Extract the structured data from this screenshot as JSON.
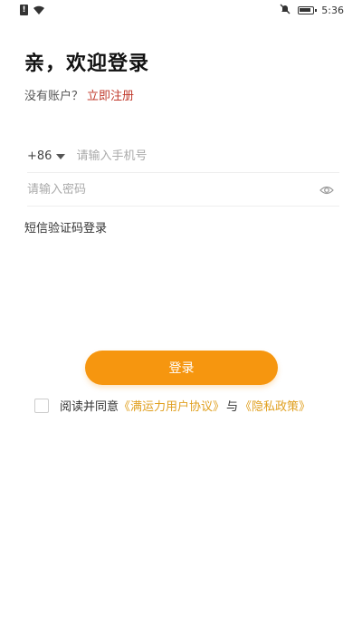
{
  "status_bar": {
    "time": "5:36",
    "icons": [
      "sim-alert-icon",
      "wifi-icon",
      "mute-icon",
      "battery-icon"
    ]
  },
  "welcome": {
    "title": "亲，欢迎登录",
    "no_account": "没有账户？",
    "register_link": "立即注册"
  },
  "form": {
    "country_code": "+86",
    "phone_placeholder": "请输入手机号",
    "password_placeholder": "请输入密码",
    "sms_login": "短信验证码登录"
  },
  "login_button": "登录",
  "agreement": {
    "prefix": "阅读并同意",
    "user_agreement": "《满运力用户协议》",
    "and": "与",
    "privacy_policy": "《隐私政策》",
    "checked": false
  },
  "colors": {
    "primary": "#f6960f",
    "register_link": "#c0392b",
    "agreement_link": "#e0a020"
  }
}
